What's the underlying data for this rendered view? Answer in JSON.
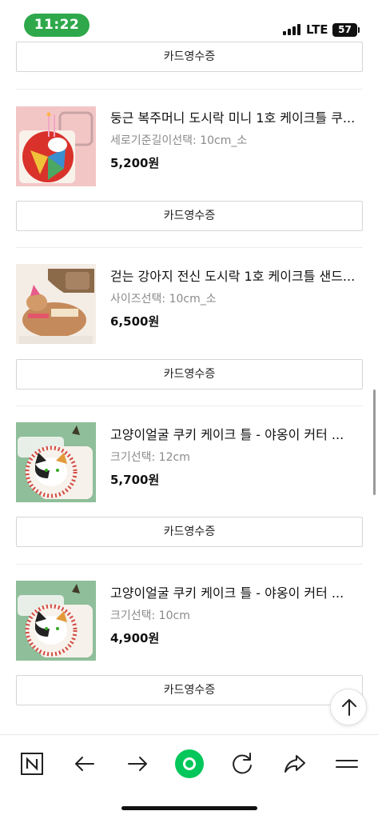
{
  "status_bar": {
    "time": "11:22",
    "network": "LTE",
    "battery": "57"
  },
  "receipt_label": "카드영수증",
  "products": [
    {
      "title": "둥근 복주머니 도시락 미니 1호 케이크틀 쿠...",
      "option": "세로기준길이선택: 10cm_소",
      "price": "5,200원"
    },
    {
      "title": "걷는 강아지 전신 도시락 1호 케이크틀 샌드...",
      "option": "사이즈선택: 10cm_소",
      "price": "6,500원"
    },
    {
      "title": "고양이얼굴 쿠키 케이크 틀 - 야옹이 커터 ...",
      "option": "크기선택: 12cm",
      "price": "5,700원"
    },
    {
      "title": "고양이얼굴 쿠키 케이크 틀 - 야옹이 커터 ...",
      "option": "크기선택: 10cm",
      "price": "4,900원"
    }
  ],
  "toolbar": {
    "icons": [
      "naver-n-icon",
      "back-arrow-icon",
      "forward-arrow-icon",
      "green-dot-icon",
      "refresh-icon",
      "share-icon",
      "menu-icon"
    ]
  },
  "colors": {
    "status_pill": "#2ea84a",
    "green_dot": "#03c75a"
  }
}
